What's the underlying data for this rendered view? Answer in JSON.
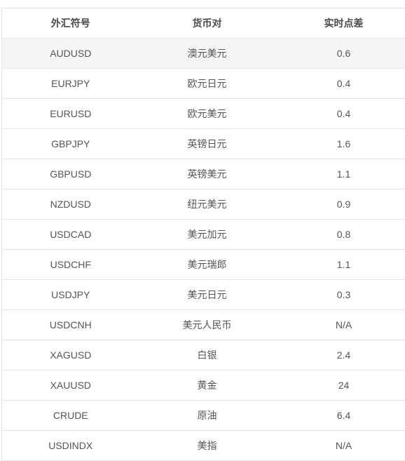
{
  "table": {
    "headers": [
      "外汇符号",
      "货币对",
      "实时点差"
    ],
    "rows": [
      {
        "symbol": "AUDUSD",
        "pair": "澳元美元",
        "spread": "0.6"
      },
      {
        "symbol": "EURJPY",
        "pair": "欧元日元",
        "spread": "0.4"
      },
      {
        "symbol": "EURUSD",
        "pair": "欧元美元",
        "spread": "0.4"
      },
      {
        "symbol": "GBPJPY",
        "pair": "英镑日元",
        "spread": "1.6"
      },
      {
        "symbol": "GBPUSD",
        "pair": "英镑美元",
        "spread": "1.1"
      },
      {
        "symbol": "NZDUSD",
        "pair": "纽元美元",
        "spread": "0.9"
      },
      {
        "symbol": "USDCAD",
        "pair": "美元加元",
        "spread": "0.8"
      },
      {
        "symbol": "USDCHF",
        "pair": "美元瑞郎",
        "spread": "1.1"
      },
      {
        "symbol": "USDJPY",
        "pair": "美元日元",
        "spread": "0.3"
      },
      {
        "symbol": "USDCNH",
        "pair": "美元人民币",
        "spread": "N/A"
      },
      {
        "symbol": "XAGUSD",
        "pair": "白银",
        "spread": "2.4"
      },
      {
        "symbol": "XAUUSD",
        "pair": "黄金",
        "spread": "24"
      },
      {
        "symbol": "CRUDE",
        "pair": "原油",
        "spread": "6.4"
      },
      {
        "symbol": "USDINDX",
        "pair": "美指",
        "spread": "N/A"
      }
    ]
  },
  "colors": {
    "border": "#e6e6e6",
    "highlight_row_bg": "#f5f5f5",
    "text": "#555555",
    "header_text": "#4a4a4a"
  }
}
